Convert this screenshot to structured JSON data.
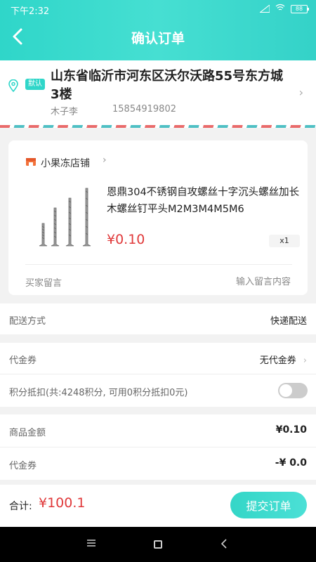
{
  "status": {
    "time": "下午2:32",
    "battery": "88"
  },
  "header": {
    "title": "确认订单"
  },
  "address": {
    "default_tag": "默认",
    "text": "山东省临沂市河东区沃尔沃路55号东方城3楼",
    "name": "木子李",
    "phone": "15854919802"
  },
  "shop": {
    "name": "小果冻店铺"
  },
  "product": {
    "title": "恩鼎304不锈钢自攻螺丝十字沉头螺丝加长木螺丝钉平头M2M3M4M5M6",
    "price": "¥0.10",
    "qty": "x1"
  },
  "message": {
    "label": "买家留言",
    "placeholder": "输入留言内容"
  },
  "delivery": {
    "label": "配送方式",
    "value": "快递配送"
  },
  "voucher": {
    "label": "代金券",
    "value": "无代金券"
  },
  "points": {
    "label": "积分抵扣(共:4248积分, 可用0积分抵扣0元)",
    "enabled": false
  },
  "summary": {
    "goods_label": "商品金额",
    "goods_value": "¥0.10",
    "voucher_label": "代金券",
    "voucher_value": "-¥ 0.0"
  },
  "footer": {
    "total_label": "合计:",
    "total_value": "¥100.1",
    "submit_label": "提交订单"
  },
  "colors": {
    "accent": "#2fd6c9",
    "price": "#e0393a"
  }
}
